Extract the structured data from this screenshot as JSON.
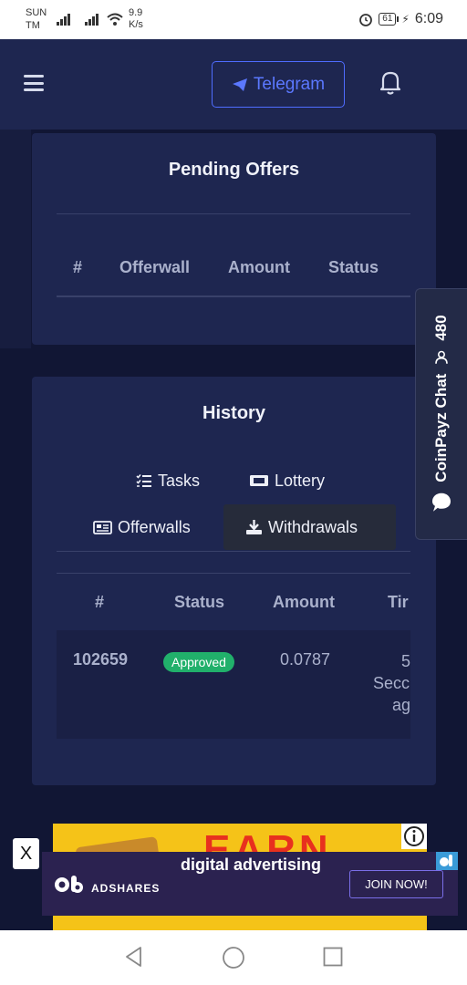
{
  "statusbar": {
    "carrier_line1": "SUN",
    "carrier_line2": "TM",
    "speed_value": "9.9",
    "speed_unit": "K/s",
    "battery": "61",
    "time": "6:09"
  },
  "header": {
    "telegram_label": "Telegram"
  },
  "pending": {
    "title": "Pending Offers",
    "columns": [
      "#",
      "Offerwall",
      "Amount",
      "Status"
    ]
  },
  "history": {
    "title": "History",
    "tabs": [
      {
        "label": "Tasks",
        "icon": "tasks-icon"
      },
      {
        "label": "Lottery",
        "icon": "ticket-icon"
      },
      {
        "label": "Offerwalls",
        "icon": "newspaper-icon"
      },
      {
        "label": "Withdrawals",
        "icon": "download-icon",
        "active": true
      }
    ],
    "columns": [
      "#",
      "Status",
      "Amount",
      "Tir"
    ],
    "rows": [
      {
        "id": "102659",
        "status": "Approved",
        "amount": "0.0787",
        "time_line1": "5",
        "time_line2": "Secc",
        "time_line3": "ag"
      }
    ]
  },
  "chat": {
    "label": "CoinPayz Chat",
    "count": "480"
  },
  "ad": {
    "close_label": "X",
    "earn_text": "EARN",
    "brand": "ADSHARES",
    "headline": "digital advertising",
    "join_label": "JOIN NOW!"
  },
  "colors": {
    "background": "#111634",
    "card": "#1e2650",
    "accent": "#4f6cff",
    "approved": "#21b06b"
  }
}
